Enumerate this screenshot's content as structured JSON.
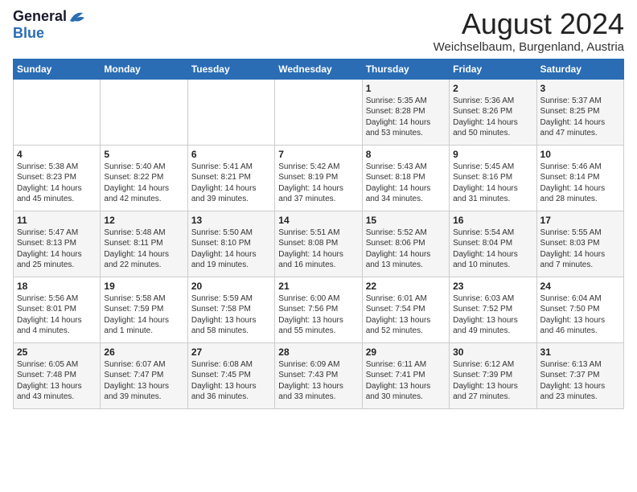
{
  "logo": {
    "general": "General",
    "blue": "Blue"
  },
  "title": "August 2024",
  "location": "Weichselbaum, Burgenland, Austria",
  "days_of_week": [
    "Sunday",
    "Monday",
    "Tuesday",
    "Wednesday",
    "Thursday",
    "Friday",
    "Saturday"
  ],
  "weeks": [
    [
      {
        "day": "",
        "info": ""
      },
      {
        "day": "",
        "info": ""
      },
      {
        "day": "",
        "info": ""
      },
      {
        "day": "",
        "info": ""
      },
      {
        "day": "1",
        "info": "Sunrise: 5:35 AM\nSunset: 8:28 PM\nDaylight: 14 hours\nand 53 minutes."
      },
      {
        "day": "2",
        "info": "Sunrise: 5:36 AM\nSunset: 8:26 PM\nDaylight: 14 hours\nand 50 minutes."
      },
      {
        "day": "3",
        "info": "Sunrise: 5:37 AM\nSunset: 8:25 PM\nDaylight: 14 hours\nand 47 minutes."
      }
    ],
    [
      {
        "day": "4",
        "info": "Sunrise: 5:38 AM\nSunset: 8:23 PM\nDaylight: 14 hours\nand 45 minutes."
      },
      {
        "day": "5",
        "info": "Sunrise: 5:40 AM\nSunset: 8:22 PM\nDaylight: 14 hours\nand 42 minutes."
      },
      {
        "day": "6",
        "info": "Sunrise: 5:41 AM\nSunset: 8:21 PM\nDaylight: 14 hours\nand 39 minutes."
      },
      {
        "day": "7",
        "info": "Sunrise: 5:42 AM\nSunset: 8:19 PM\nDaylight: 14 hours\nand 37 minutes."
      },
      {
        "day": "8",
        "info": "Sunrise: 5:43 AM\nSunset: 8:18 PM\nDaylight: 14 hours\nand 34 minutes."
      },
      {
        "day": "9",
        "info": "Sunrise: 5:45 AM\nSunset: 8:16 PM\nDaylight: 14 hours\nand 31 minutes."
      },
      {
        "day": "10",
        "info": "Sunrise: 5:46 AM\nSunset: 8:14 PM\nDaylight: 14 hours\nand 28 minutes."
      }
    ],
    [
      {
        "day": "11",
        "info": "Sunrise: 5:47 AM\nSunset: 8:13 PM\nDaylight: 14 hours\nand 25 minutes."
      },
      {
        "day": "12",
        "info": "Sunrise: 5:48 AM\nSunset: 8:11 PM\nDaylight: 14 hours\nand 22 minutes."
      },
      {
        "day": "13",
        "info": "Sunrise: 5:50 AM\nSunset: 8:10 PM\nDaylight: 14 hours\nand 19 minutes."
      },
      {
        "day": "14",
        "info": "Sunrise: 5:51 AM\nSunset: 8:08 PM\nDaylight: 14 hours\nand 16 minutes."
      },
      {
        "day": "15",
        "info": "Sunrise: 5:52 AM\nSunset: 8:06 PM\nDaylight: 14 hours\nand 13 minutes."
      },
      {
        "day": "16",
        "info": "Sunrise: 5:54 AM\nSunset: 8:04 PM\nDaylight: 14 hours\nand 10 minutes."
      },
      {
        "day": "17",
        "info": "Sunrise: 5:55 AM\nSunset: 8:03 PM\nDaylight: 14 hours\nand 7 minutes."
      }
    ],
    [
      {
        "day": "18",
        "info": "Sunrise: 5:56 AM\nSunset: 8:01 PM\nDaylight: 14 hours\nand 4 minutes."
      },
      {
        "day": "19",
        "info": "Sunrise: 5:58 AM\nSunset: 7:59 PM\nDaylight: 14 hours\nand 1 minute."
      },
      {
        "day": "20",
        "info": "Sunrise: 5:59 AM\nSunset: 7:58 PM\nDaylight: 13 hours\nand 58 minutes."
      },
      {
        "day": "21",
        "info": "Sunrise: 6:00 AM\nSunset: 7:56 PM\nDaylight: 13 hours\nand 55 minutes."
      },
      {
        "day": "22",
        "info": "Sunrise: 6:01 AM\nSunset: 7:54 PM\nDaylight: 13 hours\nand 52 minutes."
      },
      {
        "day": "23",
        "info": "Sunrise: 6:03 AM\nSunset: 7:52 PM\nDaylight: 13 hours\nand 49 minutes."
      },
      {
        "day": "24",
        "info": "Sunrise: 6:04 AM\nSunset: 7:50 PM\nDaylight: 13 hours\nand 46 minutes."
      }
    ],
    [
      {
        "day": "25",
        "info": "Sunrise: 6:05 AM\nSunset: 7:48 PM\nDaylight: 13 hours\nand 43 minutes."
      },
      {
        "day": "26",
        "info": "Sunrise: 6:07 AM\nSunset: 7:47 PM\nDaylight: 13 hours\nand 39 minutes."
      },
      {
        "day": "27",
        "info": "Sunrise: 6:08 AM\nSunset: 7:45 PM\nDaylight: 13 hours\nand 36 minutes."
      },
      {
        "day": "28",
        "info": "Sunrise: 6:09 AM\nSunset: 7:43 PM\nDaylight: 13 hours\nand 33 minutes."
      },
      {
        "day": "29",
        "info": "Sunrise: 6:11 AM\nSunset: 7:41 PM\nDaylight: 13 hours\nand 30 minutes."
      },
      {
        "day": "30",
        "info": "Sunrise: 6:12 AM\nSunset: 7:39 PM\nDaylight: 13 hours\nand 27 minutes."
      },
      {
        "day": "31",
        "info": "Sunrise: 6:13 AM\nSunset: 7:37 PM\nDaylight: 13 hours\nand 23 minutes."
      }
    ]
  ]
}
